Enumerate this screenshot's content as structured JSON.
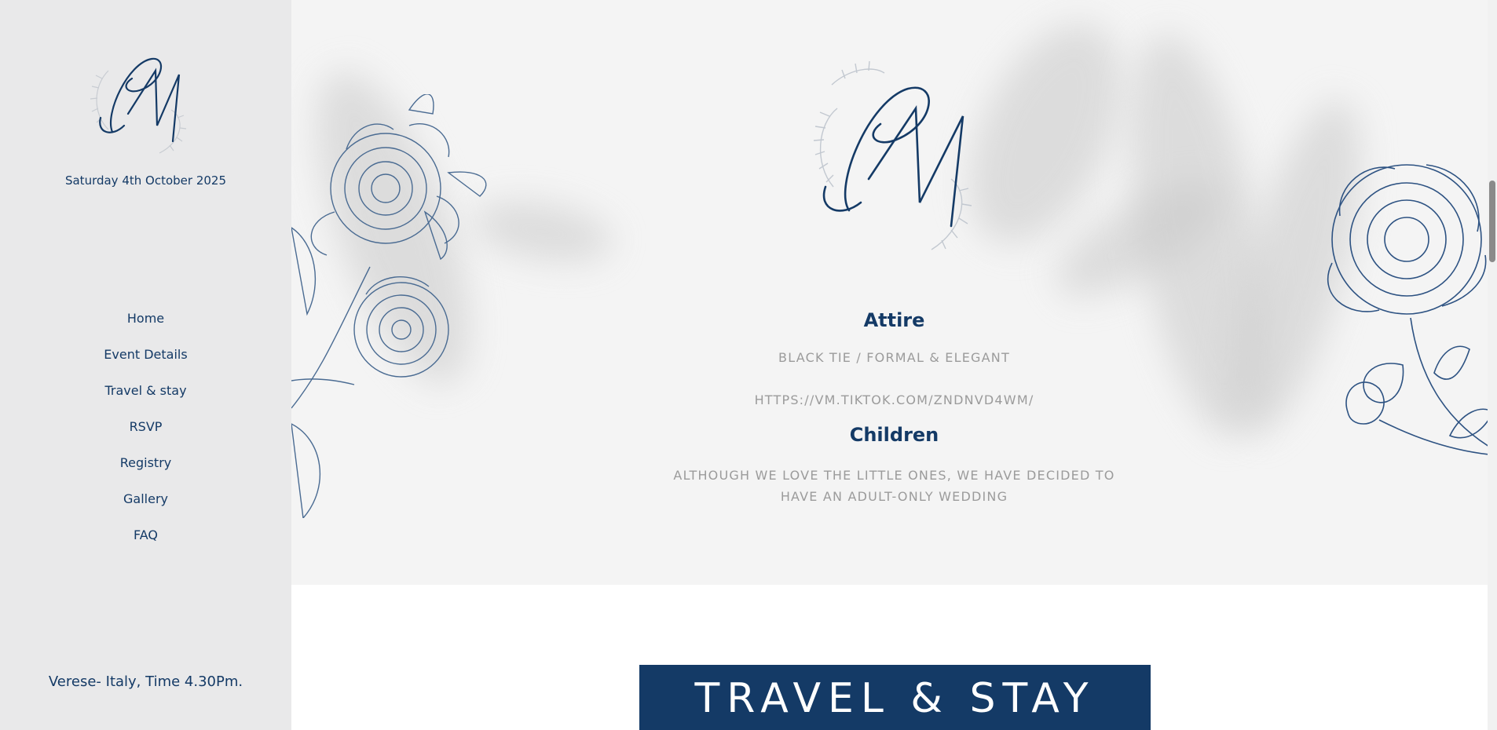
{
  "sidebar": {
    "logo_icon": "pm-monogram-icon",
    "date": "Saturday 4th October 2025",
    "nav": [
      {
        "label": "Home"
      },
      {
        "label": "Event Details"
      },
      {
        "label": "Travel & stay"
      },
      {
        "label": "RSVP"
      },
      {
        "label": "Registry"
      },
      {
        "label": "Gallery"
      },
      {
        "label": "FAQ"
      }
    ],
    "location": "Verese- Italy, Time 4.30Pm."
  },
  "hero": {
    "monogram_icon": "pm-monogram-icon",
    "attire": {
      "title": "Attire",
      "text": "BLACK TIE / FORMAL & ELEGANT",
      "link": "HTTPS://VM.TIKTOK.COM/ZNDNVD4WM/"
    },
    "children": {
      "title": "Children",
      "text_line1": "ALTHOUGH WE LOVE THE LITTLE ONES, WE HAVE DECIDED TO",
      "text_line2": "HAVE AN ADULT-ONLY WEDDING"
    }
  },
  "travel": {
    "banner": "TRAVEL & STAY"
  },
  "colors": {
    "navy": "#143a66",
    "sidebar_bg": "#e9e9ea",
    "muted_text": "#9b9b9b"
  }
}
